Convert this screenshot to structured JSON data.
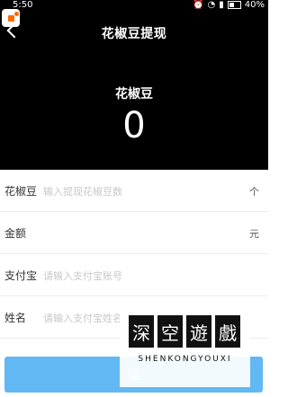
{
  "status_bar": {
    "time": "5:50",
    "battery": "40%"
  },
  "header": {
    "title": "花椒豆提现",
    "balance_label": "花椒豆",
    "balance_value": "0"
  },
  "form": {
    "rows": [
      {
        "label": "花椒豆",
        "placeholder": "输入提现花椒豆数",
        "unit": "个"
      },
      {
        "label": "金额",
        "placeholder": "",
        "unit": "元"
      },
      {
        "label": "支付宝",
        "placeholder": "请输入支付宝账号",
        "unit": ""
      },
      {
        "label": "姓名",
        "placeholder": "请输入支付宝姓名",
        "unit": ""
      }
    ]
  },
  "submit_button": {
    "label": "提"
  },
  "watermark": {
    "chars": [
      "深",
      "空",
      "遊",
      "戲"
    ],
    "subtitle": "SHENKONGYOUXI"
  },
  "colors": {
    "header_bg": "#000000",
    "button_bg": "#62b8f2",
    "badge_accent": "#ff6a00"
  }
}
